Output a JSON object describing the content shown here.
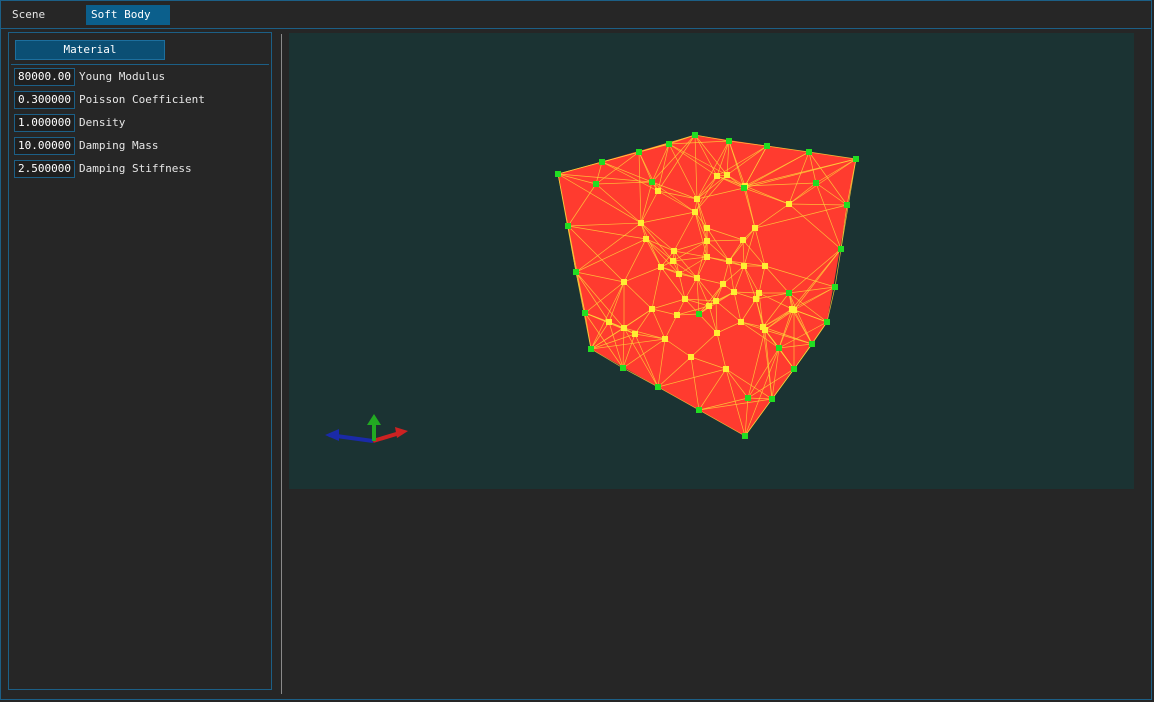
{
  "tabs": [
    {
      "label": "Scene",
      "active": false
    },
    {
      "label": "Soft Body",
      "active": true
    }
  ],
  "panel": {
    "material_button": "Material",
    "properties": [
      {
        "value": "80000.00",
        "label": "Young Modulus"
      },
      {
        "value": "0.300000",
        "label": "Poisson Coefficient"
      },
      {
        "value": "1.000000",
        "label": "Density"
      },
      {
        "value": "10.00000",
        "label": "Damping Mass"
      },
      {
        "value": "2.500000",
        "label": "Damping Stiffness"
      }
    ]
  },
  "viewport": {
    "background": "#1b3333",
    "mesh_color": "#ff3b2f",
    "edge_color": "#ffd23a",
    "surface_node_color": "#22dd22",
    "interior_node_color": "#ffee33",
    "axis_colors": {
      "x": "#cc2222",
      "y": "#22aa22",
      "z": "#1a2aa8"
    }
  }
}
